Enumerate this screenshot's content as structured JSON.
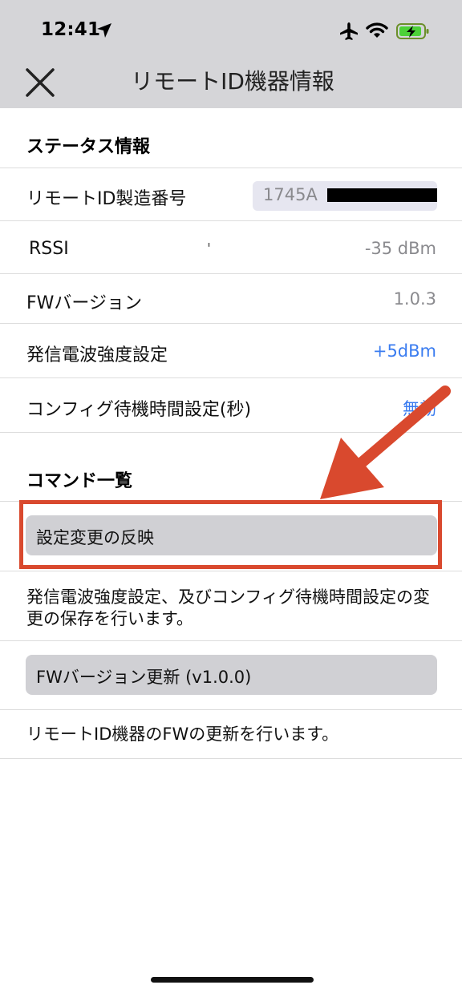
{
  "status_bar": {
    "time": "12:41",
    "icons": [
      "location-arrow-icon",
      "airplane-icon",
      "wifi-icon",
      "battery-charging-icon"
    ]
  },
  "nav": {
    "title": "リモートID機器情報",
    "close_icon": "close-icon"
  },
  "status_section": {
    "title": "ステータス情報",
    "rows": [
      {
        "label": "リモートID製造番号",
        "value": "1745A"
      },
      {
        "label": "RSSI",
        "value": "-35 dBm",
        "mark": "'"
      },
      {
        "label": "FWバージョン",
        "value": "1.0.3"
      },
      {
        "label": "発信電波強度設定",
        "value": "+5dBm"
      },
      {
        "label": "コンフィグ待機時間設定(秒)",
        "value": "無効"
      }
    ]
  },
  "command_section": {
    "title": "コマンド一覧",
    "commands": [
      {
        "label": "設定変更の反映",
        "description": "発信電波強度設定、及びコンフィグ待機時間設定の変更の保存を行います。"
      },
      {
        "label": "FWバージョン更新 (v1.0.0)",
        "description": "リモートID機器のFWの更新を行います。"
      }
    ]
  },
  "colors": {
    "header_bg": "#d5d5d8",
    "link_blue": "#3a7cf0",
    "annotation_red": "#d9492e",
    "button_bg": "#d0d0d4"
  }
}
